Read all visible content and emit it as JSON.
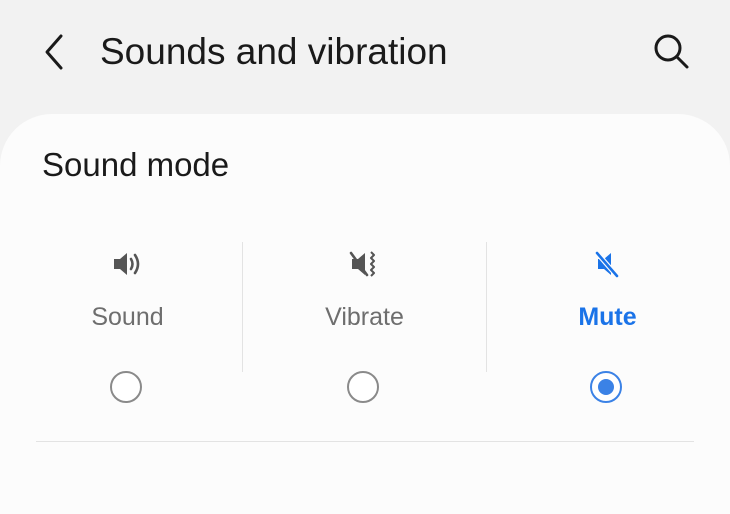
{
  "header": {
    "title": "Sounds and vibration",
    "back_icon": "chevron-left-icon",
    "search_icon": "search-icon"
  },
  "sound_mode": {
    "title": "Sound mode",
    "options": [
      {
        "label": "Sound",
        "icon": "speaker-icon",
        "selected": false
      },
      {
        "label": "Vibrate",
        "icon": "vibrate-icon",
        "selected": false
      },
      {
        "label": "Mute",
        "icon": "mute-icon",
        "selected": true
      }
    ],
    "selected_color": "#3b82e6",
    "label_color": "#6e6e6e"
  }
}
